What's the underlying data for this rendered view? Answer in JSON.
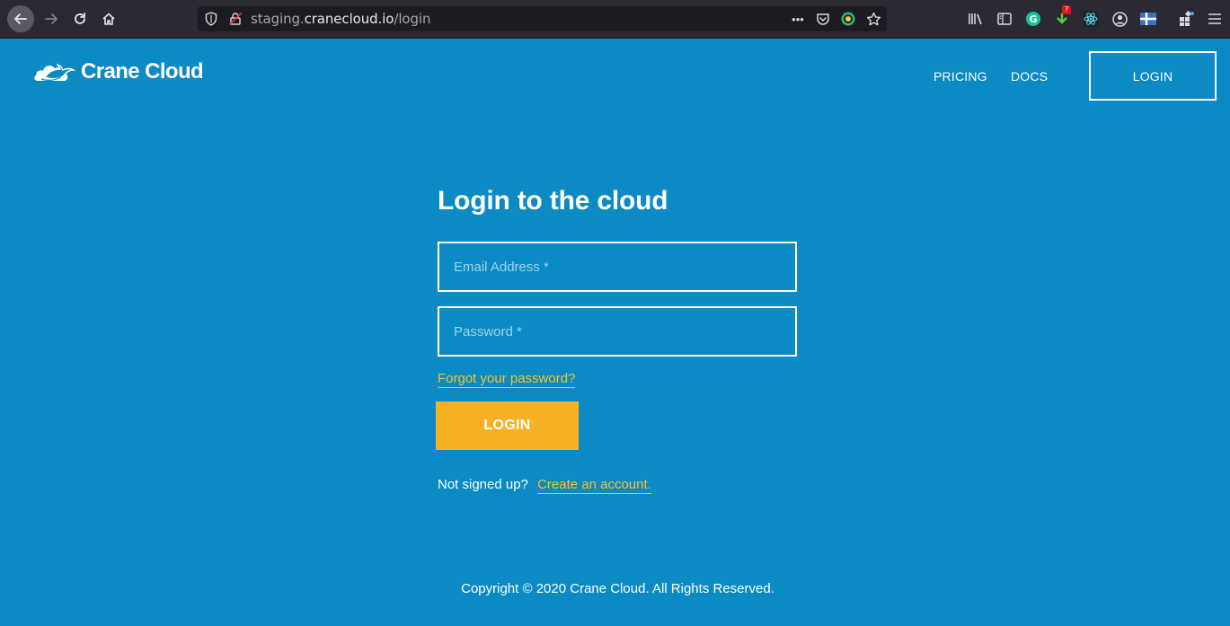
{
  "browser": {
    "url_prefix": "staging.",
    "url_domain": "cranecloud.io",
    "url_path": "/login",
    "download_badge": "?"
  },
  "header": {
    "logo_text": "Crane Cloud",
    "nav": {
      "pricing": "PRICING",
      "docs": "DOCS",
      "login": "LOGIN"
    }
  },
  "form": {
    "title": "Login to the cloud",
    "email_placeholder": "Email Address *",
    "email_value": "",
    "password_placeholder": "Password *",
    "password_value": "",
    "forgot_link": "Forgot your password?",
    "login_button": "LOGIN",
    "signup_prompt": "Not signed up?",
    "signup_link": "Create an account."
  },
  "footer": {
    "copyright": "Copyright © 2020 Crane Cloud. All Rights Reserved."
  },
  "colors": {
    "page_background": "#0b8ac3",
    "accent_yellow": "#f7b125",
    "link_yellow": "#f8c22a",
    "browser_chrome": "#2b2a33"
  },
  "icons": [
    "back-arrow-icon",
    "forward-arrow-icon",
    "reload-icon",
    "home-icon",
    "tracking-shield-icon",
    "insecure-lock-icon",
    "page-actions-icon",
    "pocket-icon",
    "extension-target-icon",
    "bookmark-star-icon",
    "library-icon",
    "sidebar-icon",
    "grammarly-icon",
    "download-icon",
    "react-devtools-icon",
    "account-icon",
    "extension-flag-icon",
    "extensions-icon",
    "menu-icon",
    "crane-logo-icon"
  ]
}
